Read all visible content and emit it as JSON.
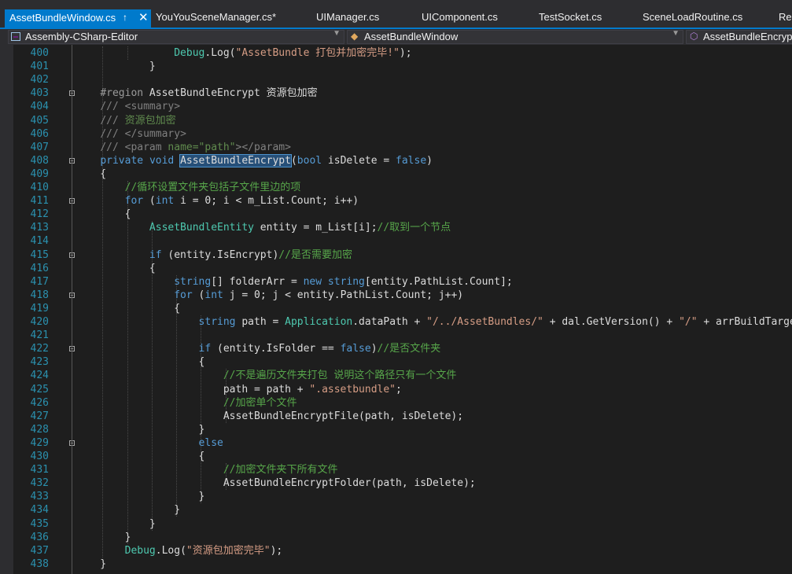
{
  "tabs": {
    "active": {
      "label": "AssetBundleWindow.cs",
      "pin": "↑",
      "close": "✕"
    },
    "others": [
      "YouYouSceneManager.cs*",
      "UIManager.cs",
      "UIComponent.cs",
      "TestSocket.cs",
      "SceneLoadRoutine.cs",
      "Re"
    ]
  },
  "navbar": {
    "project": "Assembly-CSharp-Editor",
    "type": "AssetBundleWindow",
    "member": "AssetBundleEncrypt("
  },
  "lines": [
    {
      "n": "400",
      "t": "                Debug.Log(\"AssetBundle 打包并加密完毕!\");"
    },
    {
      "n": "401",
      "t": "            }"
    },
    {
      "n": "402",
      "t": ""
    },
    {
      "n": "403",
      "t": "    #region AssetBundleEncrypt 资源包加密"
    },
    {
      "n": "404",
      "t": "    /// <summary>"
    },
    {
      "n": "405",
      "t": "    /// 资源包加密"
    },
    {
      "n": "406",
      "t": "    /// </summary>"
    },
    {
      "n": "407",
      "t": "    /// <param name=\"path\"></param>"
    },
    {
      "n": "408",
      "t": "    private void AssetBundleEncrypt(bool isDelete = false)"
    },
    {
      "n": "409",
      "t": "    {"
    },
    {
      "n": "410",
      "t": "        //循环设置文件夹包括子文件里边的项"
    },
    {
      "n": "411",
      "t": "        for (int i = 0; i < m_List.Count; i++)"
    },
    {
      "n": "412",
      "t": "        {"
    },
    {
      "n": "413",
      "t": "            AssetBundleEntity entity = m_List[i];//取到一个节点"
    },
    {
      "n": "414",
      "t": ""
    },
    {
      "n": "415",
      "t": "            if (entity.IsEncrypt)//是否需要加密"
    },
    {
      "n": "416",
      "t": "            {"
    },
    {
      "n": "417",
      "t": "                string[] folderArr = new string[entity.PathList.Count];"
    },
    {
      "n": "418",
      "t": "                for (int j = 0; j < entity.PathList.Count; j++)"
    },
    {
      "n": "419",
      "t": "                {"
    },
    {
      "n": "420",
      "t": "                    string path = Application.dataPath + \"/../AssetBundles/\" + dal.GetVersion() + \"/\" + arrBuildTarget[bui"
    },
    {
      "n": "421",
      "t": ""
    },
    {
      "n": "422",
      "t": "                    if (entity.IsFolder == false)//是否文件夹"
    },
    {
      "n": "423",
      "t": "                    {"
    },
    {
      "n": "424",
      "t": "                        //不是遍历文件夹打包 说明这个路径只有一个文件"
    },
    {
      "n": "425",
      "t": "                        path = path + \".assetbundle\";"
    },
    {
      "n": "426",
      "t": "                        //加密单个文件"
    },
    {
      "n": "427",
      "t": "                        AssetBundleEncryptFile(path, isDelete);"
    },
    {
      "n": "428",
      "t": "                    }"
    },
    {
      "n": "429",
      "t": "                    else"
    },
    {
      "n": "430",
      "t": "                    {"
    },
    {
      "n": "431",
      "t": "                        //加密文件夹下所有文件"
    },
    {
      "n": "432",
      "t": "                        AssetBundleEncryptFolder(path, isDelete);"
    },
    {
      "n": "433",
      "t": "                    }"
    },
    {
      "n": "434",
      "t": "                }"
    },
    {
      "n": "435",
      "t": "            }"
    },
    {
      "n": "436",
      "t": "        }"
    },
    {
      "n": "437",
      "t": "        Debug.Log(\"资源包加密完毕\");"
    },
    {
      "n": "438",
      "t": "    }"
    }
  ],
  "colors": {
    "background": "#1e1e1e",
    "keyword": "#569cd6",
    "type": "#4ec9b0",
    "string": "#d69d85",
    "comment": "#57a64a",
    "line_number": "#2b91af",
    "accent": "#007acc"
  },
  "icons": [
    "pin-icon",
    "close-icon",
    "project-icon",
    "class-icon",
    "method-icon",
    "chevron-down-icon",
    "fold-toggle-icon"
  ]
}
